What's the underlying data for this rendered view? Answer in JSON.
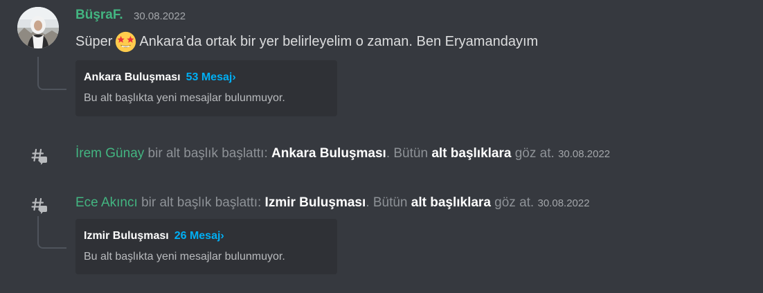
{
  "message": {
    "author": "BüşraF.",
    "timestamp": "30.08.2022",
    "text_before": "Süper",
    "emoji": "star-struck-emoji",
    "text_after": "Ankara’da ortak bir yer belirleyelim o zaman. Ben Eryamandayım"
  },
  "threads": [
    {
      "name": "Ankara Buluşması",
      "count_label": "53 Mesaj›",
      "status": "Bu alt başlıkta yeni mesajlar bulunmuyor."
    },
    {
      "name": "Izmir Buluşması",
      "count_label": "26 Mesaj›",
      "status": "Bu alt başlıkta yeni mesajlar bulunmuyor."
    }
  ],
  "system_events": [
    {
      "user": "İrem Günay",
      "action": "bir alt başlık başlattı:",
      "thread": "Ankara Buluşması",
      "middle": ". Bütün",
      "link": "alt başlıklara",
      "tail": "göz at.",
      "timestamp": "30.08.2022"
    },
    {
      "user": "Ece Akıncı",
      "action": "bir alt başlık başlattı:",
      "thread": "Izmir Buluşması",
      "middle": ". Bütün",
      "link": "alt başlıklara",
      "tail": "göz at.",
      "timestamp": "30.08.2022"
    }
  ],
  "colors": {
    "background": "#36393f",
    "card": "#2f3136",
    "username": "#43b581",
    "link": "#00aff4",
    "muted": "#8e9297"
  }
}
